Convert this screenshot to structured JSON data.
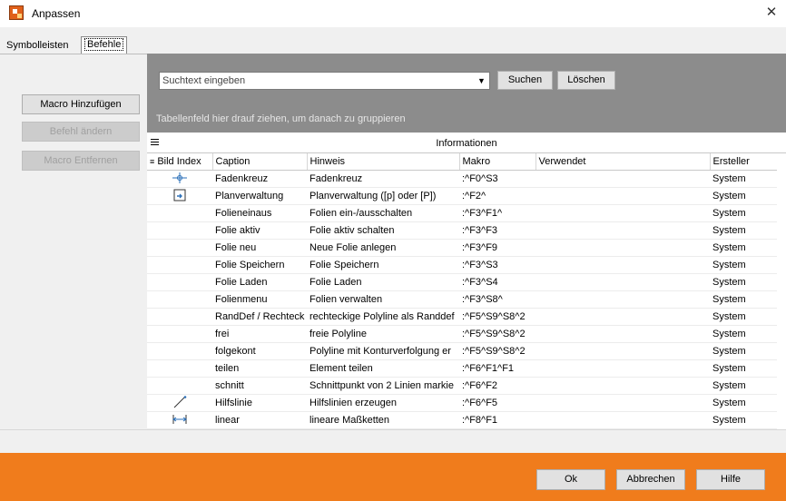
{
  "window": {
    "title": "Anpassen"
  },
  "tabs": [
    {
      "label": "Symbolleisten"
    },
    {
      "label": "Befehle"
    }
  ],
  "left_buttons": {
    "add_macro": "Macro Hinzufügen",
    "edit_command": "Befehl ändern",
    "remove_macro": "Macro Entfernen"
  },
  "search": {
    "placeholder": "Suchtext eingeben",
    "search_label": "Suchen",
    "clear_label": "Löschen"
  },
  "group_hint": "Tabellenfeld hier drauf ziehen, um danach zu gruppieren",
  "band_label": "Informationen",
  "columns": [
    "Bild Index",
    "Caption",
    "Hinweis",
    "Makro",
    "Verwendet",
    "Ersteller"
  ],
  "rows": [
    {
      "icon": "crosshair-icon",
      "caption": "Fadenkreuz",
      "hint": "Fadenkreuz",
      "macro": ":^F0^S3",
      "used": "",
      "creator": "System"
    },
    {
      "icon": "plan-manager-icon",
      "caption": "Planverwaltung",
      "hint": "Planverwaltung ([p] oder [P])",
      "macro": ":^F2^",
      "used": "",
      "creator": "System"
    },
    {
      "icon": "",
      "caption": "Folieneinaus",
      "hint": "Folien ein-/ausschalten",
      "macro": ":^F3^F1^",
      "used": "",
      "creator": "System"
    },
    {
      "icon": "",
      "caption": "Folie aktiv",
      "hint": "Folie aktiv schalten",
      "macro": ":^F3^F3",
      "used": "",
      "creator": "System"
    },
    {
      "icon": "",
      "caption": "Folie neu",
      "hint": "Neue Folie anlegen",
      "macro": ":^F3^F9",
      "used": "",
      "creator": "System"
    },
    {
      "icon": "",
      "caption": "Folie Speichern",
      "hint": "Folie Speichern",
      "macro": ":^F3^S3",
      "used": "",
      "creator": "System"
    },
    {
      "icon": "",
      "caption": "Folie Laden",
      "hint": "Folie Laden",
      "macro": ":^F3^S4",
      "used": "",
      "creator": "System"
    },
    {
      "icon": "",
      "caption": "Folienmenu",
      "hint": "Folien verwalten",
      "macro": ":^F3^S8^",
      "used": "",
      "creator": "System"
    },
    {
      "icon": "",
      "caption": "RandDef / Rechteck",
      "hint": "rechteckige Polyline als Randdef",
      "macro": ":^F5^S9^S8^2",
      "used": "",
      "creator": "System"
    },
    {
      "icon": "",
      "caption": "frei",
      "hint": "freie Polyline",
      "macro": ":^F5^S9^S8^2",
      "used": "",
      "creator": "System"
    },
    {
      "icon": "",
      "caption": "folgekont",
      "hint": "Polyline mit Konturverfolgung er",
      "macro": ":^F5^S9^S8^2",
      "used": "",
      "creator": "System"
    },
    {
      "icon": "",
      "caption": "teilen",
      "hint": "Element teilen",
      "macro": ":^F6^F1^F1",
      "used": "",
      "creator": "System"
    },
    {
      "icon": "",
      "caption": "schnitt",
      "hint": "Schnittpunkt von 2 Linien markie",
      "macro": ":^F6^F2",
      "used": "",
      "creator": "System"
    },
    {
      "icon": "auxiliary-line-icon",
      "caption": "Hilfslinie",
      "hint": "Hilfslinien erzeugen",
      "macro": ":^F6^F5",
      "used": "",
      "creator": "System"
    },
    {
      "icon": "linear-dimension-icon",
      "caption": "linear",
      "hint": "lineare Maßketten",
      "macro": ":^F8^F1",
      "used": "",
      "creator": "System"
    }
  ],
  "footer": {
    "ok": "Ok",
    "cancel": "Abbrechen",
    "help": "Hilfe"
  },
  "colors": {
    "accent": "#f07c1c",
    "grey_panel": "#8c8c8c",
    "icon_blue": "#2a6fb8"
  }
}
